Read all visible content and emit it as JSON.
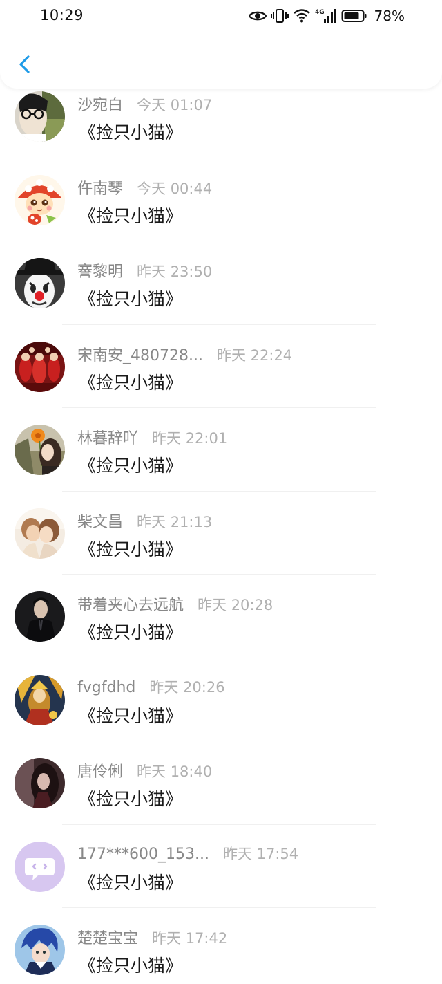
{
  "status_bar": {
    "time": "10:29",
    "battery": "78%",
    "icons": [
      "eye-icon",
      "vibrate-icon",
      "wifi-icon",
      "4g-signal-icon",
      "battery-icon"
    ]
  },
  "header": {
    "back_icon": "chevron-left-icon",
    "accent_color": "#1e9be8"
  },
  "messages": [
    {
      "name": "沙宛白",
      "time": "今天 01:07",
      "text": "《捡只小猫》",
      "avatar": "photo-man-glasses"
    },
    {
      "name": "仵南琴",
      "time": "今天 00:44",
      "text": "《捡只小猫》",
      "avatar": "cartoon-mushroom-girl"
    },
    {
      "name": "謇黎明",
      "time": "昨天 23:50",
      "text": "《捡只小猫》",
      "avatar": "clown-hat"
    },
    {
      "name": "宋南安_480728...",
      "time": "昨天 22:24",
      "text": "《捡只小猫》",
      "avatar": "red-group-photo"
    },
    {
      "name": "林暮辞吖",
      "time": "昨天 22:01",
      "text": "《捡只小猫》",
      "avatar": "girl-with-flower"
    },
    {
      "name": "柴文昌",
      "time": "昨天 21:13",
      "text": "《捡只小猫》",
      "avatar": "couple-kiss"
    },
    {
      "name": "带着夹心去远航",
      "time": "昨天 20:28",
      "text": "《捡只小猫》",
      "avatar": "man-dark-suit"
    },
    {
      "name": "fvgfdhd",
      "time": "昨天 20:26",
      "text": "《捡只小猫》",
      "avatar": "game-character-gold"
    },
    {
      "name": "唐伶俐",
      "time": "昨天 18:40",
      "text": "《捡只小猫》",
      "avatar": "dark-portrait"
    },
    {
      "name": "177***600_153...",
      "time": "昨天 17:54",
      "text": "《捡只小猫》",
      "avatar": "default-chat-bubble"
    },
    {
      "name": "楚楚宝宝",
      "time": "昨天 17:42",
      "text": "《捡只小猫》",
      "avatar": "anime-blue-hair"
    }
  ]
}
